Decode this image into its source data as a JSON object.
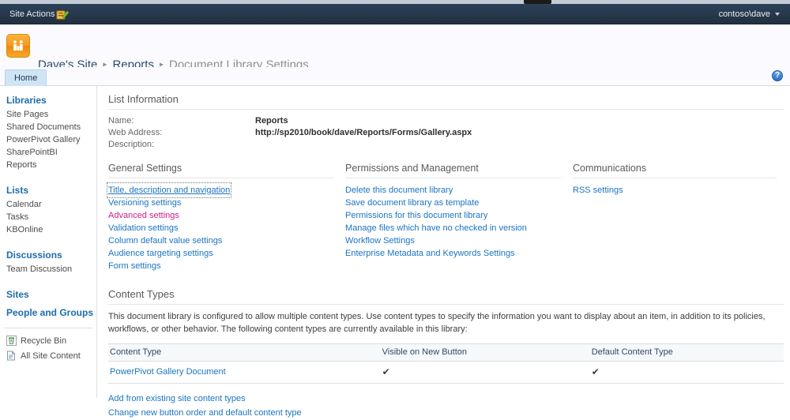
{
  "suite_bar": {
    "site_actions_label": "Site Actions",
    "site_actions_caret": "dropdown-caret",
    "nav_edit_icon": "navigate-up-edit-icon",
    "user_name": "contoso\\dave",
    "user_caret": "dropdown-caret"
  },
  "header": {
    "logo_icon": "sharepoint-team-site-logo",
    "breadcrumb": {
      "site": "Dave's Site",
      "sep1": "▸",
      "library": "Reports",
      "sep2": "▸",
      "current": "Document Library Settings"
    }
  },
  "ribbon": {
    "home_tab": "Home",
    "help_icon": "help-question-icon",
    "help_glyph": "?"
  },
  "left_nav": {
    "groups": [
      {
        "heading": "Libraries",
        "items": [
          "Site Pages",
          "Shared Documents",
          "PowerPivot Gallery",
          "SharePointBI",
          "Reports"
        ]
      },
      {
        "heading": "Lists",
        "items": [
          "Calendar",
          "Tasks",
          "KBOnline"
        ]
      },
      {
        "heading": "Discussions",
        "items": [
          "Team Discussion"
        ]
      }
    ],
    "sites_heading": "Sites",
    "people_heading": "People and Groups",
    "recycle_bin": "Recycle Bin",
    "recycle_bin_icon": "recycle-bin-icon",
    "all_site_content": "All Site Content",
    "all_site_content_icon": "all-site-content-icon"
  },
  "list_information": {
    "section_title": "List Information",
    "fields": [
      {
        "label": "Name:",
        "value": "Reports"
      },
      {
        "label": "Web Address:",
        "value": "http://sp2010/book/dave/Reports/Forms/Gallery.aspx"
      },
      {
        "label": "Description:",
        "value": ""
      }
    ]
  },
  "general_settings": {
    "title": "General Settings",
    "links": [
      {
        "label": "Title, description and navigation",
        "state": "focused"
      },
      {
        "label": "Versioning settings",
        "state": "normal"
      },
      {
        "label": "Advanced settings",
        "state": "visited"
      },
      {
        "label": "Validation settings",
        "state": "normal"
      },
      {
        "label": "Column default value settings",
        "state": "normal"
      },
      {
        "label": "Audience targeting settings",
        "state": "normal"
      },
      {
        "label": "Form settings",
        "state": "normal"
      }
    ]
  },
  "permissions_management": {
    "title": "Permissions and Management",
    "links": [
      {
        "label": "Delete this document library",
        "state": "normal"
      },
      {
        "label": "Save document library as template",
        "state": "normal"
      },
      {
        "label": "Permissions for this document library",
        "state": "normal"
      },
      {
        "label": "Manage files which have no checked in version",
        "state": "normal"
      },
      {
        "label": "Workflow Settings",
        "state": "normal"
      },
      {
        "label": "Enterprise Metadata and Keywords Settings",
        "state": "normal"
      }
    ]
  },
  "communications": {
    "title": "Communications",
    "links": [
      {
        "label": "RSS settings",
        "state": "normal"
      }
    ]
  },
  "content_types": {
    "section_title": "Content Types",
    "description": "This document library is configured to allow multiple content types. Use content types to specify the information you want to display about an item, in addition to its policies, workflows, or other behavior. The following content types are currently available in this library:",
    "columns": [
      "Content Type",
      "Visible on New Button",
      "Default Content Type"
    ],
    "rows": [
      {
        "name": "PowerPivot Gallery Document",
        "visible_on_new_button": "✔",
        "default_content_type": "✔"
      }
    ],
    "actions": [
      "Add from existing site content types",
      "Change new button order and default content type"
    ]
  },
  "colors": {
    "suite_bar": "#26384c",
    "link": "#1b74c0",
    "visited_link": "#cf1e8c",
    "nav_heading": "#1c6cae",
    "logo_orange": "#f59a1e",
    "tab_active": "#cfe5f5"
  }
}
